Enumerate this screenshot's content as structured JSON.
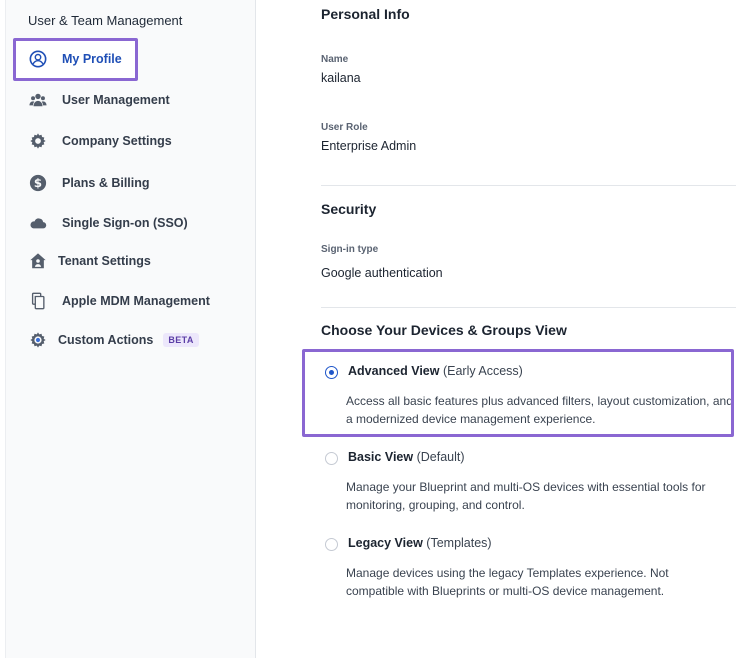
{
  "sidebar": {
    "heading": "User & Team Management",
    "items": [
      {
        "label": "My Profile",
        "icon": "user-circle-icon",
        "active": true
      },
      {
        "label": "User Management",
        "icon": "users-icon"
      },
      {
        "label": "Company Settings",
        "icon": "gear-icon"
      },
      {
        "label": "Plans & Billing",
        "icon": "dollar-icon"
      },
      {
        "label": "Single Sign-on (SSO)",
        "icon": "cloud-icon"
      },
      {
        "label": "Tenant Settings",
        "icon": "house-user-icon"
      },
      {
        "label": "Apple MDM Management",
        "icon": "documents-icon"
      },
      {
        "label": "Custom Actions",
        "icon": "cog-badge-icon",
        "badge": "BETA"
      }
    ]
  },
  "personal_info": {
    "title": "Personal Info",
    "name_label": "Name",
    "name_value": "kailana",
    "role_label": "User Role",
    "role_value": "Enterprise Admin"
  },
  "security": {
    "title": "Security",
    "signin_label": "Sign-in type",
    "signin_value": "Google authentication"
  },
  "view_choice": {
    "title": "Choose Your Devices & Groups View",
    "options": [
      {
        "name": "Advanced View",
        "tag": "(Early Access)",
        "selected": true,
        "description": "Access all basic features plus advanced filters, layout customization, and a modernized device management experience."
      },
      {
        "name": "Basic View",
        "tag": "(Default)",
        "selected": false,
        "description": "Manage your Blueprint and multi-OS devices with essential tools for monitoring, grouping, and control."
      },
      {
        "name": "Legacy View",
        "tag": "(Templates)",
        "selected": false,
        "description": "Manage devices using the legacy Templates experience. Not compatible with Blueprints or multi-OS device management."
      }
    ]
  },
  "colors": {
    "accent": "#1f56c9",
    "highlight": "#8a67d2"
  }
}
